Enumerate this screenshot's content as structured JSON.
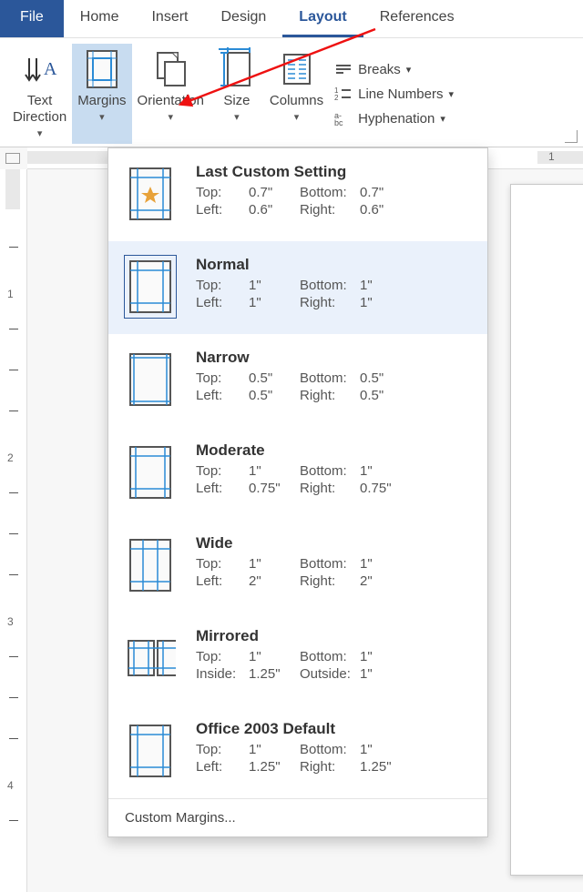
{
  "tabs": {
    "file": "File",
    "home": "Home",
    "insert": "Insert",
    "design": "Design",
    "layout": "Layout",
    "references": "References"
  },
  "ribbon": {
    "text_direction": "Text\nDirection",
    "margins": "Margins",
    "orientation": "Orientation",
    "size": "Size",
    "columns": "Columns",
    "breaks": "Breaks",
    "line_numbers": "Line Numbers",
    "hyphenation": "Hyphenation"
  },
  "ruler": {
    "h1": "1"
  },
  "vruler_nums": [
    "1",
    "2",
    "3",
    "4"
  ],
  "dropdown": {
    "options": [
      {
        "title": "Last Custom Setting",
        "k1": "Top:",
        "v1": "0.7\"",
        "k2": "Bottom:",
        "v2": "0.7\"",
        "k3": "Left:",
        "v3": "0.6\"",
        "k4": "Right:",
        "v4": "0.6\"",
        "selected": false,
        "icon": "star"
      },
      {
        "title": "Normal",
        "k1": "Top:",
        "v1": "1\"",
        "k2": "Bottom:",
        "v2": "1\"",
        "k3": "Left:",
        "v3": "1\"",
        "k4": "Right:",
        "v4": "1\"",
        "selected": true,
        "icon": "normal"
      },
      {
        "title": "Narrow",
        "k1": "Top:",
        "v1": "0.5\"",
        "k2": "Bottom:",
        "v2": "0.5\"",
        "k3": "Left:",
        "v3": "0.5\"",
        "k4": "Right:",
        "v4": "0.5\"",
        "selected": false,
        "icon": "narrow"
      },
      {
        "title": "Moderate",
        "k1": "Top:",
        "v1": "1\"",
        "k2": "Bottom:",
        "v2": "1\"",
        "k3": "Left:",
        "v3": "0.75\"",
        "k4": "Right:",
        "v4": "0.75\"",
        "selected": false,
        "icon": "moderate"
      },
      {
        "title": "Wide",
        "k1": "Top:",
        "v1": "1\"",
        "k2": "Bottom:",
        "v2": "1\"",
        "k3": "Left:",
        "v3": "2\"",
        "k4": "Right:",
        "v4": "2\"",
        "selected": false,
        "icon": "wide"
      },
      {
        "title": "Mirrored",
        "k1": "Top:",
        "v1": "1\"",
        "k2": "Bottom:",
        "v2": "1\"",
        "k3": "Inside:",
        "v3": "1.25\"",
        "k4": "Outside:",
        "v4": "1\"",
        "selected": false,
        "icon": "mirrored"
      },
      {
        "title": "Office 2003 Default",
        "k1": "Top:",
        "v1": "1\"",
        "k2": "Bottom:",
        "v2": "1\"",
        "k3": "Left:",
        "v3": "1.25\"",
        "k4": "Right:",
        "v4": "1.25\"",
        "selected": false,
        "icon": "normal"
      }
    ],
    "custom": "Custom Margins..."
  }
}
